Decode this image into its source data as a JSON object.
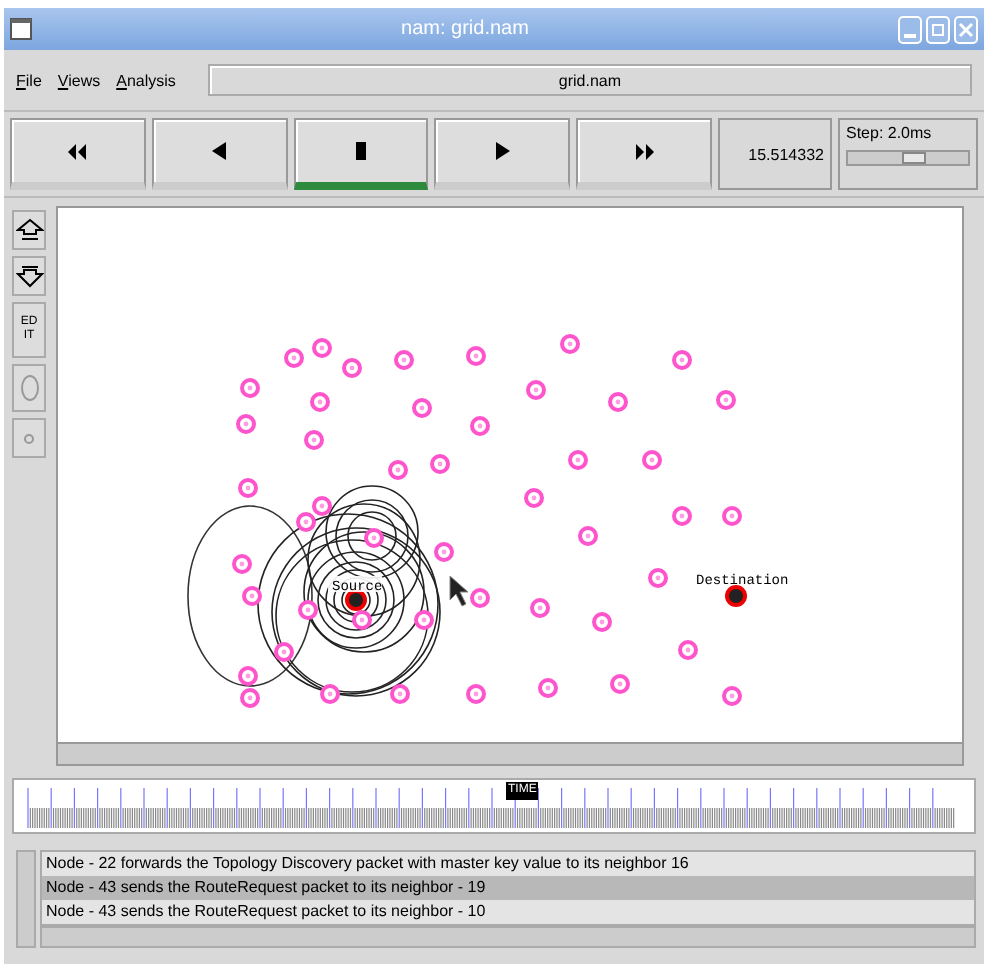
{
  "window": {
    "title": "nam: grid.nam"
  },
  "menu": [
    {
      "label": "File"
    },
    {
      "label": "Views"
    },
    {
      "label": "Analysis"
    }
  ],
  "file_field": {
    "value": "grid.nam"
  },
  "playback": [
    {
      "kind": "rewind",
      "selected": false
    },
    {
      "kind": "back",
      "selected": false
    },
    {
      "kind": "stop",
      "selected": true
    },
    {
      "kind": "play",
      "selected": false
    },
    {
      "kind": "forward",
      "selected": false
    }
  ],
  "time": "15.514332",
  "step": {
    "label": "Step: 2.0ms",
    "level": 0.55
  },
  "tools": [
    {
      "kind": "zoom-in"
    },
    {
      "kind": "zoom-out"
    },
    {
      "kind": "edit",
      "label": "EDIT"
    },
    {
      "kind": "ellipse"
    },
    {
      "kind": "dot"
    }
  ],
  "canvas": {
    "source_label": "Source",
    "destination_label": "Destination"
  },
  "timeline": {
    "marker": "TIME"
  },
  "log": [
    {
      "text": "Node - 22 forwards the Topology Discovery packet with master key value to its neighbor 16",
      "selected": false
    },
    {
      "text": "Node - 43 sends the RouteRequest packet to its neighbor - 19",
      "selected": true
    },
    {
      "text": "Node - 43 sends the RouteRequest packet to its neighbor - 10",
      "selected": false
    }
  ]
}
